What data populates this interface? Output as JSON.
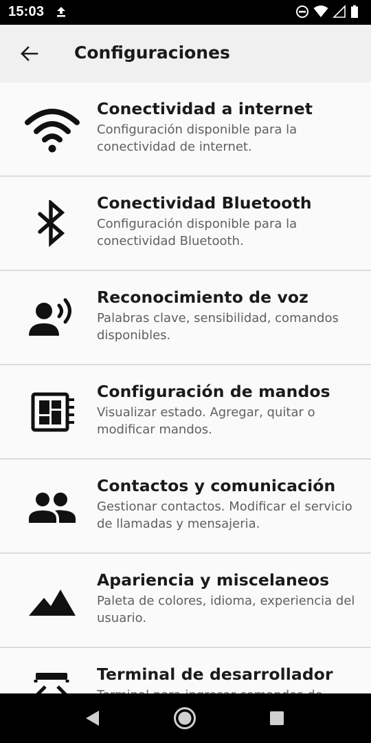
{
  "status_bar": {
    "time": "15:03",
    "icons": [
      "upload-icon",
      "do-not-disturb-icon",
      "wifi-icon",
      "cell-signal-icon",
      "battery-icon"
    ]
  },
  "app_bar": {
    "title": "Configuraciones",
    "back_icon": "arrow-back-icon"
  },
  "settings": [
    {
      "icon": "wifi-icon",
      "title": "Conectividad a internet",
      "description": "Configuración disponible para la conectividad de internet."
    },
    {
      "icon": "bluetooth-icon",
      "title": "Conectividad Bluetooth",
      "description": "Configuración disponible para la conectividad Bluetooth."
    },
    {
      "icon": "voice-recognition-icon",
      "title": "Reconocimiento de voz",
      "description": "Palabras clave, sensibilidad, comandos disponibles."
    },
    {
      "icon": "controller-board-icon",
      "title": "Configuración de mandos",
      "description": "Visualizar estado. Agregar, quitar o modificar mandos."
    },
    {
      "icon": "people-icon",
      "title": "Contactos y comunicación",
      "description": "Gestionar contactos. Modificar el servicio de llamadas y mensajeria."
    },
    {
      "icon": "landscape-icon",
      "title": "Apariencia y miscelaneos",
      "description": "Paleta de colores, idioma, experiencia del usuario."
    },
    {
      "icon": "developer-terminal-icon",
      "title": "Terminal de desarrollador",
      "description": "Terminal para ingresar comandos de"
    }
  ],
  "nav_bar": {
    "icons": [
      "back-triangle-icon",
      "home-circle-icon",
      "recents-square-icon"
    ]
  }
}
